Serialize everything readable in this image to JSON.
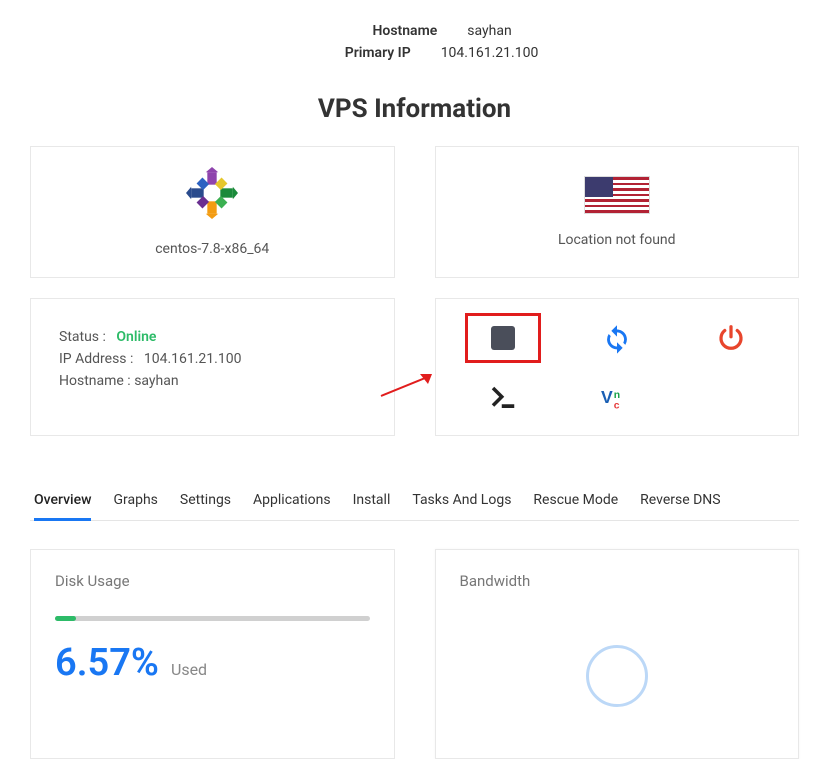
{
  "header": {
    "hostname_label": "Hostname",
    "hostname_value": "sayhan",
    "ip_label": "Primary IP",
    "ip_value": "104.161.21.100"
  },
  "section_title": "VPS Information",
  "os": {
    "name": "centos-7.8-x86_64"
  },
  "location": {
    "text": "Location not found"
  },
  "status": {
    "label": "Status :",
    "value": "Online",
    "ip_label": "IP Address :",
    "ip_value": "104.161.21.100",
    "host_label": "Hostname :",
    "host_value": "sayhan"
  },
  "tabs": {
    "overview": "Overview",
    "graphs": "Graphs",
    "settings": "Settings",
    "applications": "Applications",
    "install": "Install",
    "tasks": "Tasks And Logs",
    "rescue": "Rescue Mode",
    "rdns": "Reverse DNS"
  },
  "disk": {
    "title": "Disk Usage",
    "percent_text": "6.57%",
    "percent_num": 6.57,
    "used_label": "Used"
  },
  "bandwidth": {
    "title": "Bandwidth"
  }
}
